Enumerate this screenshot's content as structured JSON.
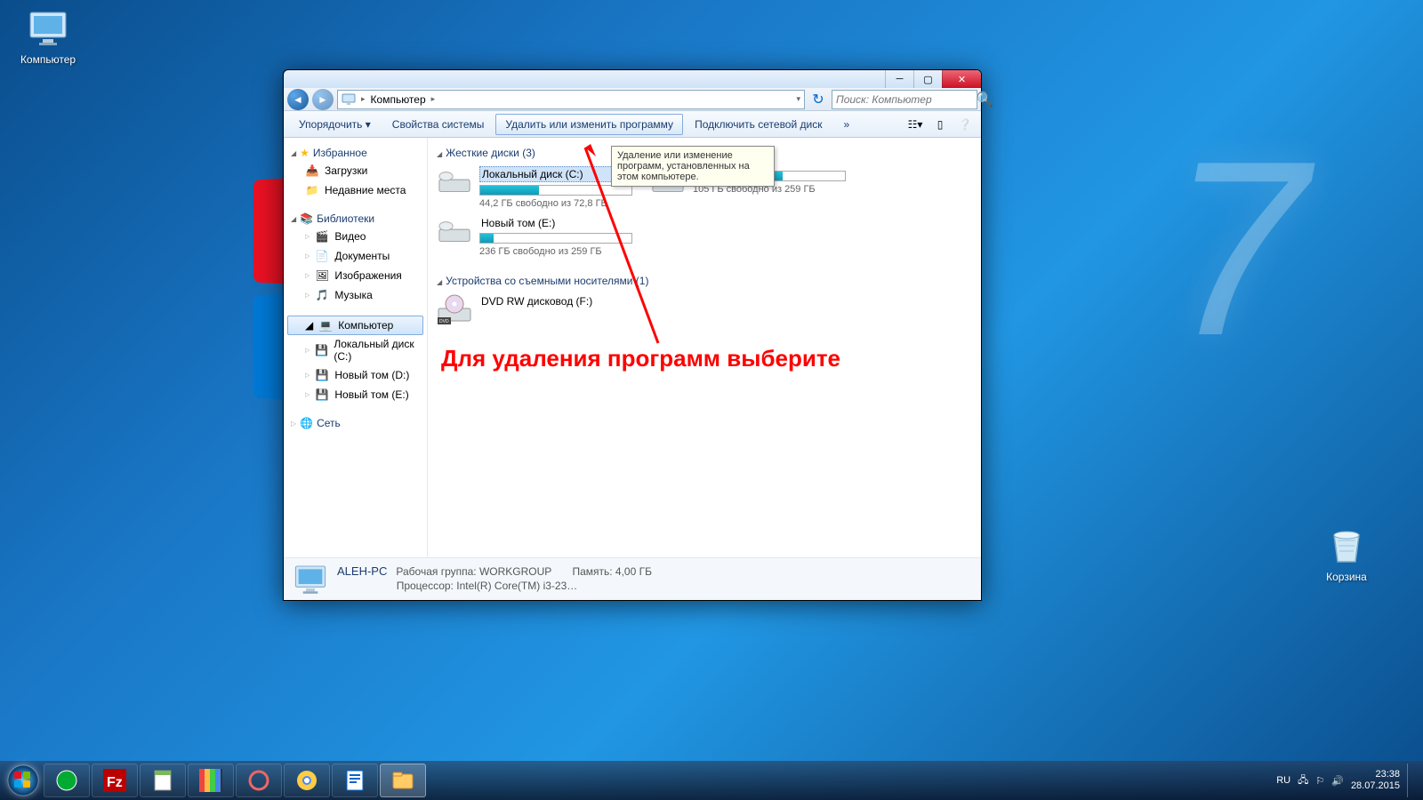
{
  "desktop": {
    "computer": "Компьютер",
    "recycle": "Корзина"
  },
  "window": {
    "breadcrumb": {
      "root": "Компьютер"
    },
    "search_placeholder": "Поиск: Компьютер",
    "toolbar": {
      "organize": "Упорядочить",
      "properties": "Свойства системы",
      "uninstall": "Удалить или изменить программу",
      "map_drive": "Подключить сетевой диск",
      "more": "»"
    },
    "tooltip": "Удаление или изменение программ, установленных на этом компьютере.",
    "sidebar": {
      "favorites": "Избранное",
      "fav_items": [
        "Загрузки",
        "Недавние места"
      ],
      "libraries": "Библиотеки",
      "lib_items": [
        "Видео",
        "Документы",
        "Изображения",
        "Музыка"
      ],
      "computer": "Компьютер",
      "comp_items": [
        "Локальный диск (C:)",
        "Новый том (D:)",
        "Новый том (E:)"
      ],
      "network": "Сеть"
    },
    "content": {
      "hdd_header": "Жесткие диски (3)",
      "drives": [
        {
          "name": "Локальный диск (C:)",
          "free": "44,2 ГБ свободно из 72,8 ГБ",
          "fill": 39
        },
        {
          "name": "",
          "free": "105 ГБ свободно из 259 ГБ",
          "fill": 59
        },
        {
          "name": "Новый том (E:)",
          "free": "236 ГБ свободно из 259 ГБ",
          "fill": 9
        }
      ],
      "removable_header": "Устройства со съемными носителями (1)",
      "dvd": "DVD RW дисковод (F:)"
    },
    "status": {
      "name": "ALEH-PC",
      "workgroup_label": "Рабочая группа:",
      "workgroup": "WORKGROUP",
      "memory_label": "Память:",
      "memory": "4,00 ГБ",
      "cpu_label": "Процессор:",
      "cpu": "Intel(R) Core(TM) i3-23…"
    }
  },
  "annotation": "Для удаления программ выберите",
  "taskbar": {
    "lang": "RU",
    "time": "23:38",
    "date": "28.07.2015"
  }
}
